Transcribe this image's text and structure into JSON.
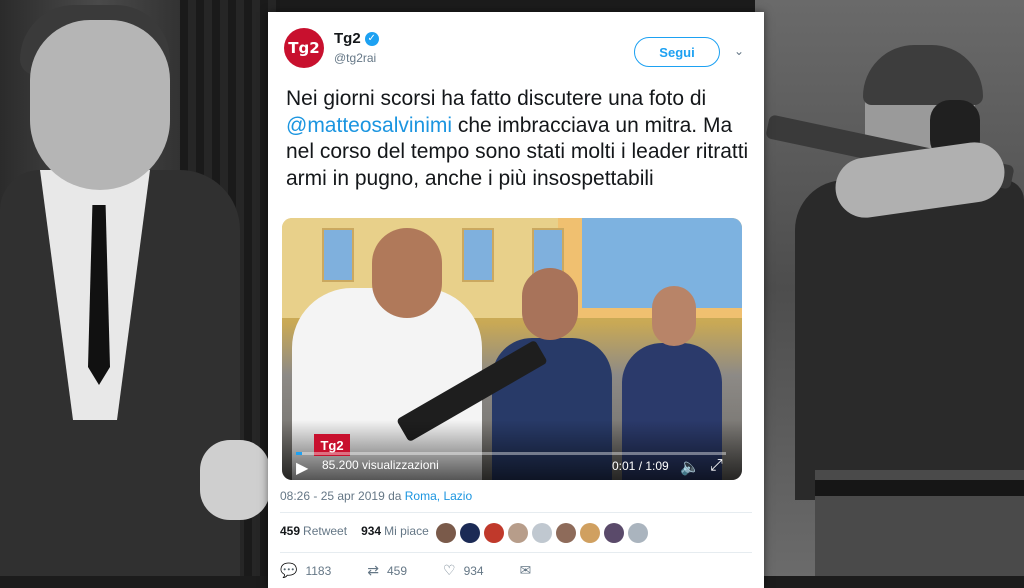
{
  "tweet": {
    "display_name": "Tg2",
    "handle": "@tg2rai",
    "avatar_text": "Tg2",
    "follow_label": "Segui",
    "text_before": "Nei giorni scorsi ha fatto discutere una foto di",
    "mention": "@matteosalvinimi",
    "text_after": " che imbracciava un mitra. Ma nel corso del tempo sono stati molti i leader ritratti armi in pugno, anche i più insospettabili",
    "timestamp": "08:26 - 25 apr 2019 da ",
    "location": "Roma, Lazio"
  },
  "video": {
    "logo_text": "Tg2",
    "views": "85.200 visualizzazioni",
    "time": "0:01 / 1:09",
    "progress": 0.015
  },
  "stats": {
    "retweet_count": "459",
    "retweet_label": "Retweet",
    "like_count": "934",
    "like_label": "Mi piace",
    "liker_colors": [
      "#7a5a4a",
      "#1b2a55",
      "#c0392b",
      "#b79d8a",
      "#c0c8d0",
      "#8e6b5a",
      "#d0a060",
      "#5a4a6a",
      "#aab4be"
    ]
  },
  "actions": {
    "reply_count": "1183",
    "retweet_count": "459",
    "like_count": "934"
  },
  "colors": {
    "accent": "#1da1f2",
    "brand": "#c8102e"
  }
}
